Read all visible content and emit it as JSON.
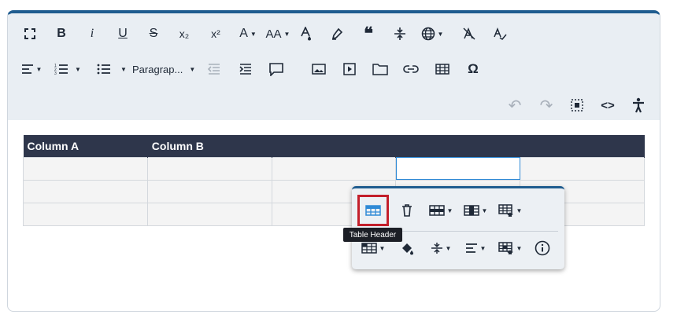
{
  "toolbar": {
    "row1": [
      "fullscreen",
      "bold",
      "italic",
      "underline",
      "strikethrough",
      "subscript",
      "superscript",
      "font-color",
      "font-size",
      "highlight",
      "clear-format",
      "quote",
      "insert-divider",
      "language",
      "remove-format",
      "spell-check"
    ],
    "paragraph_label": "Paragrap...",
    "bold_label": "B",
    "italic_label": "i",
    "underline_label": "U",
    "strike_label": "S",
    "sub_label": "x₂",
    "sup_label": "x²",
    "font_a_label": "A",
    "font_size_label": "AA",
    "quote_label": "❝",
    "omega_label": "Ω",
    "undo_label": "↶",
    "redo_label": "↷",
    "code_label": "<>"
  },
  "table": {
    "headers": [
      "Column A",
      "Column B",
      "",
      "",
      ""
    ],
    "rows": 3
  },
  "table_popup": {
    "tooltip": "Table Header"
  },
  "colors": {
    "accent": "#1f5c8f",
    "header_bg": "#2e364b",
    "active_border": "#c31f2b",
    "toolbar_bg": "#e9eef3"
  }
}
